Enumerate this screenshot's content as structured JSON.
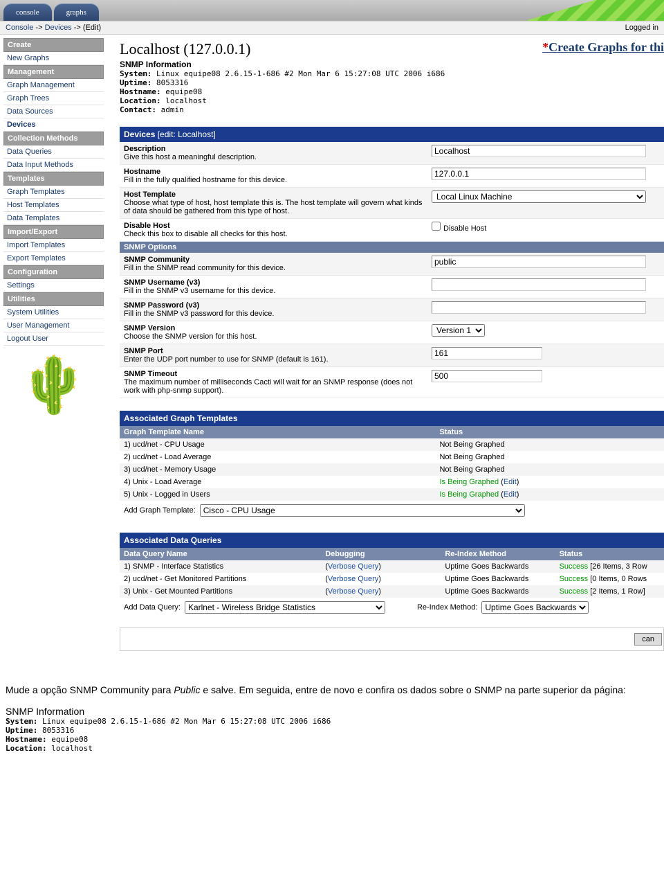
{
  "tabs": {
    "console": "console",
    "graphs": "graphs"
  },
  "breadcrumb": {
    "console": "Console",
    "devices": "Devices",
    "edit": "(Edit)",
    "logged": "Logged in"
  },
  "sidebar": {
    "sections": {
      "create": "Create",
      "management": "Management",
      "collection": "Collection Methods",
      "templates": "Templates",
      "importexport": "Import/Export",
      "configuration": "Configuration",
      "utilities": "Utilities"
    },
    "items": {
      "new_graphs": "New Graphs",
      "graph_management": "Graph Management",
      "graph_trees": "Graph Trees",
      "data_sources": "Data Sources",
      "devices": "Devices",
      "data_queries": "Data Queries",
      "data_input_methods": "Data Input Methods",
      "graph_templates": "Graph Templates",
      "host_templates": "Host Templates",
      "data_templates": "Data Templates",
      "import_templates": "Import Templates",
      "export_templates": "Export Templates",
      "settings": "Settings",
      "system_utilities": "System Utilities",
      "user_management": "User Management",
      "logout_user": "Logout User"
    }
  },
  "host": {
    "title": "Localhost (127.0.0.1)",
    "snmp_title": "SNMP Information",
    "system_label": "System:",
    "system": " Linux equipe08 2.6.15-1-686 #2 Mon Mar 6 15:27:08 UTC 2006 i686",
    "uptime_label": "Uptime:",
    "uptime": " 8053316",
    "hostname_label": "Hostname:",
    "hostname": " equipe08",
    "location_label": "Location:",
    "location": " localhost",
    "contact_label": "Contact:",
    "contact": " admin",
    "create_link": "Create Graphs for thi"
  },
  "devices_panel": {
    "header": "Devices",
    "header_sub": "[edit: Localhost]",
    "desc_label": "Description",
    "desc_help": "Give this host a meaningful description.",
    "desc_value": "Localhost",
    "hostname_label": "Hostname",
    "hostname_help": "Fill in the fully qualified hostname for this device.",
    "hostname_value": "127.0.0.1",
    "hosttmpl_label": "Host Template",
    "hosttmpl_help": "Choose what type of host, host template this is. The host template will govern what kinds of data should be gathered from this type of host.",
    "hosttmpl_value": "Local Linux Machine",
    "disable_label": "Disable Host",
    "disable_help": "Check this box to disable all checks for this host.",
    "disable_chk": "Disable Host"
  },
  "snmp_options": {
    "header": "SNMP Options",
    "comm_label": "SNMP Community",
    "comm_help": "Fill in the SNMP read community for this device.",
    "comm_value": "public",
    "user_label": "SNMP Username (v3)",
    "user_help": "Fill in the SNMP v3 username for this device.",
    "user_value": "",
    "pass_label": "SNMP Password (v3)",
    "pass_help": "Fill in the SNMP v3 password for this device.",
    "pass_value": "",
    "ver_label": "SNMP Version",
    "ver_help": "Choose the SNMP version for this host.",
    "ver_value": "Version 1",
    "port_label": "SNMP Port",
    "port_help": "Enter the UDP port number to use for SNMP (default is 161).",
    "port_value": "161",
    "timeout_label": "SNMP Timeout",
    "timeout_help": "The maximum number of milliseconds Cacti will wait for an SNMP response (does not work with php-snmp support).",
    "timeout_value": "500"
  },
  "assoc_graph": {
    "header": "Associated Graph Templates",
    "col_name": "Graph Template Name",
    "col_status": "Status",
    "rows": [
      {
        "n": "1)",
        "name": "ucd/net - CPU Usage",
        "status": "Not Being Graphed",
        "graphed": false
      },
      {
        "n": "2)",
        "name": "ucd/net - Load Average",
        "status": "Not Being Graphed",
        "graphed": false
      },
      {
        "n": "3)",
        "name": "ucd/net - Memory Usage",
        "status": "Not Being Graphed",
        "graphed": false
      },
      {
        "n": "4)",
        "name": "Unix - Load Average",
        "status": "Is Being Graphed",
        "edit": "Edit",
        "graphed": true
      },
      {
        "n": "5)",
        "name": "Unix - Logged in Users",
        "status": "Is Being Graphed",
        "edit": "Edit",
        "graphed": true
      }
    ],
    "add_label": "Add Graph Template:",
    "add_value": "Cisco - CPU Usage"
  },
  "assoc_data": {
    "header": "Associated Data Queries",
    "col_name": "Data Query Name",
    "col_debug": "Debugging",
    "col_reindex": "Re-Index Method",
    "col_status": "Status",
    "rows": [
      {
        "n": "1)",
        "name": "SNMP - Interface Statistics",
        "debug": "Verbose Query",
        "reindex": "Uptime Goes Backwards",
        "status_pre": "Success",
        "status_post": " [26 Items, 3 Row"
      },
      {
        "n": "2)",
        "name": "ucd/net - Get Monitored Partitions",
        "debug": "Verbose Query",
        "reindex": "Uptime Goes Backwards",
        "status_pre": "Success",
        "status_post": " [0 Items, 0 Rows"
      },
      {
        "n": "3)",
        "name": "Unix - Get Mounted Partitions",
        "debug": "Verbose Query",
        "reindex": "Uptime Goes Backwards",
        "status_pre": "Success",
        "status_post": " [2 Items, 1 Row]"
      }
    ],
    "add_label": "Add Data Query:",
    "add_value": "Karlnet - Wireless Bridge Statistics",
    "reindex_label": "Re-Index Method:",
    "reindex_value": "Uptime Goes Backwards"
  },
  "cancel": "can",
  "bottom": {
    "para1a": "Mude a opção SNMP Community para ",
    "para1b": "Public",
    "para1c": " e salve. Em seguida, entre de novo e confira os dados sobre o SNMP na parte superior da página:",
    "title": "SNMP Information",
    "system_label": "System:",
    "system": " Linux equipe08 2.6.15-1-686 #2 Mon Mar 6 15:27:08 UTC 2006 i686",
    "uptime_label": "Uptime:",
    "uptime": " 8053316",
    "hostname_label": "Hostname:",
    "hostname": " equipe08",
    "location_label": "Location:",
    "location": " localhost"
  }
}
